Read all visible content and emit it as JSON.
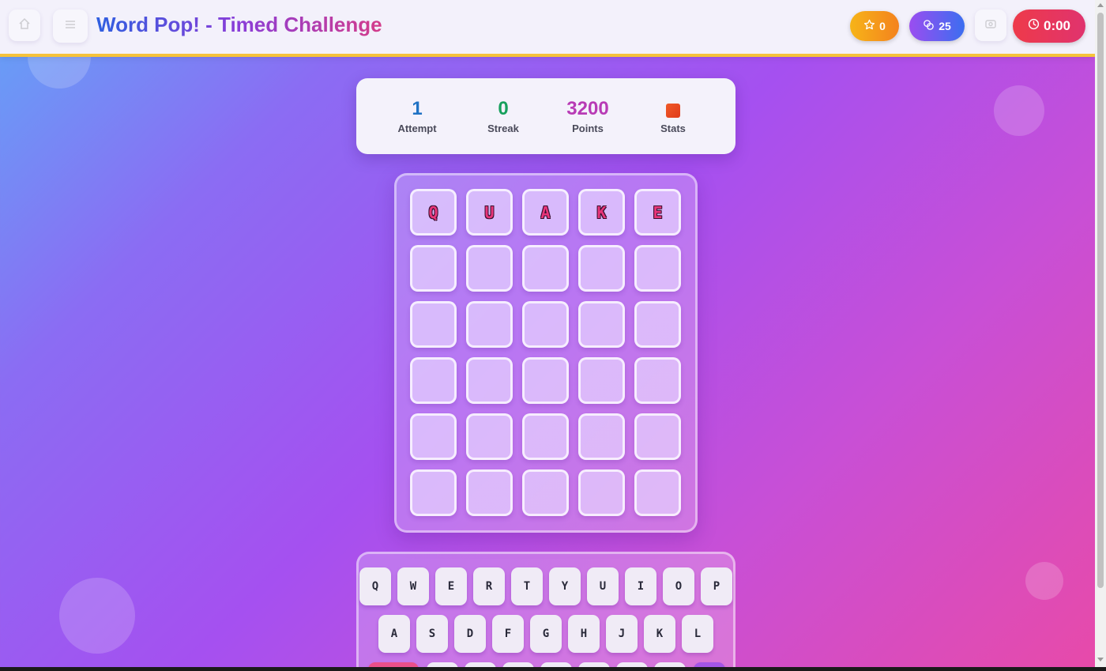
{
  "header": {
    "title": "Word Pop! - Timed Challenge",
    "stars": "0",
    "coins": "25",
    "timer": "0:00",
    "icons": {
      "home": "home-icon",
      "menu": "menu-icon",
      "star": "star-icon",
      "coins": "coins-icon",
      "settings": "settings-icon",
      "clock": "clock-icon"
    }
  },
  "stats": {
    "attempt": {
      "value": "1",
      "label": "Attempt",
      "color": "#1f72c4"
    },
    "streak": {
      "value": "0",
      "label": "Streak",
      "color": "#17a05d"
    },
    "points": {
      "value": "3200",
      "label": "Points",
      "color": "#b83bb5"
    },
    "stats_button": {
      "label": "Stats",
      "icon": "stats-icon"
    }
  },
  "board": {
    "rows": [
      [
        "Q",
        "U",
        "A",
        "K",
        "E"
      ],
      [
        "",
        "",
        "",
        "",
        ""
      ],
      [
        "",
        "",
        "",
        "",
        ""
      ],
      [
        "",
        "",
        "",
        "",
        ""
      ],
      [
        "",
        "",
        "",
        "",
        ""
      ],
      [
        "",
        "",
        "",
        "",
        ""
      ]
    ]
  },
  "keyboard": {
    "row1": [
      "Q",
      "W",
      "E",
      "R",
      "T",
      "Y",
      "U",
      "I",
      "O",
      "P"
    ],
    "row2": [
      "A",
      "S",
      "D",
      "F",
      "G",
      "H",
      "J",
      "K",
      "L"
    ]
  }
}
